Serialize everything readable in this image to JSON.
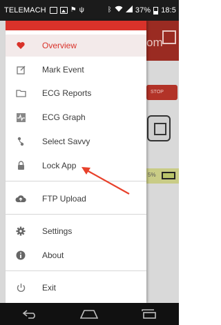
{
  "status_bar": {
    "carrier": "TELEMACH",
    "battery_percent": "37%",
    "time": "18:5"
  },
  "background_app": {
    "header_text_partial": "om",
    "stop_label": "STOP",
    "battery_text_partial": "5%"
  },
  "drawer": {
    "accent_color": "#d9322a",
    "items": [
      {
        "label": "Overview",
        "icon": "heart-icon",
        "active": true
      },
      {
        "label": "Mark Event",
        "icon": "edit-icon",
        "active": false
      },
      {
        "label": "ECG Reports",
        "icon": "folder-icon",
        "active": false
      },
      {
        "label": "ECG Graph",
        "icon": "graph-icon",
        "active": false
      },
      {
        "label": "Select Savvy",
        "icon": "device-icon",
        "active": false
      },
      {
        "label": "Lock App",
        "icon": "lock-icon",
        "active": false
      },
      {
        "label": "FTP Upload",
        "icon": "cloud-upload-icon",
        "active": false
      },
      {
        "label": "Settings",
        "icon": "gear-icon",
        "active": false
      },
      {
        "label": "About",
        "icon": "info-icon",
        "active": false
      },
      {
        "label": "Exit",
        "icon": "power-icon",
        "active": false
      }
    ]
  },
  "nav_bar": {
    "buttons": [
      "back",
      "home",
      "recents"
    ]
  },
  "annotation": {
    "arrow_color": "#e8412b",
    "points_to": "Lock App"
  }
}
